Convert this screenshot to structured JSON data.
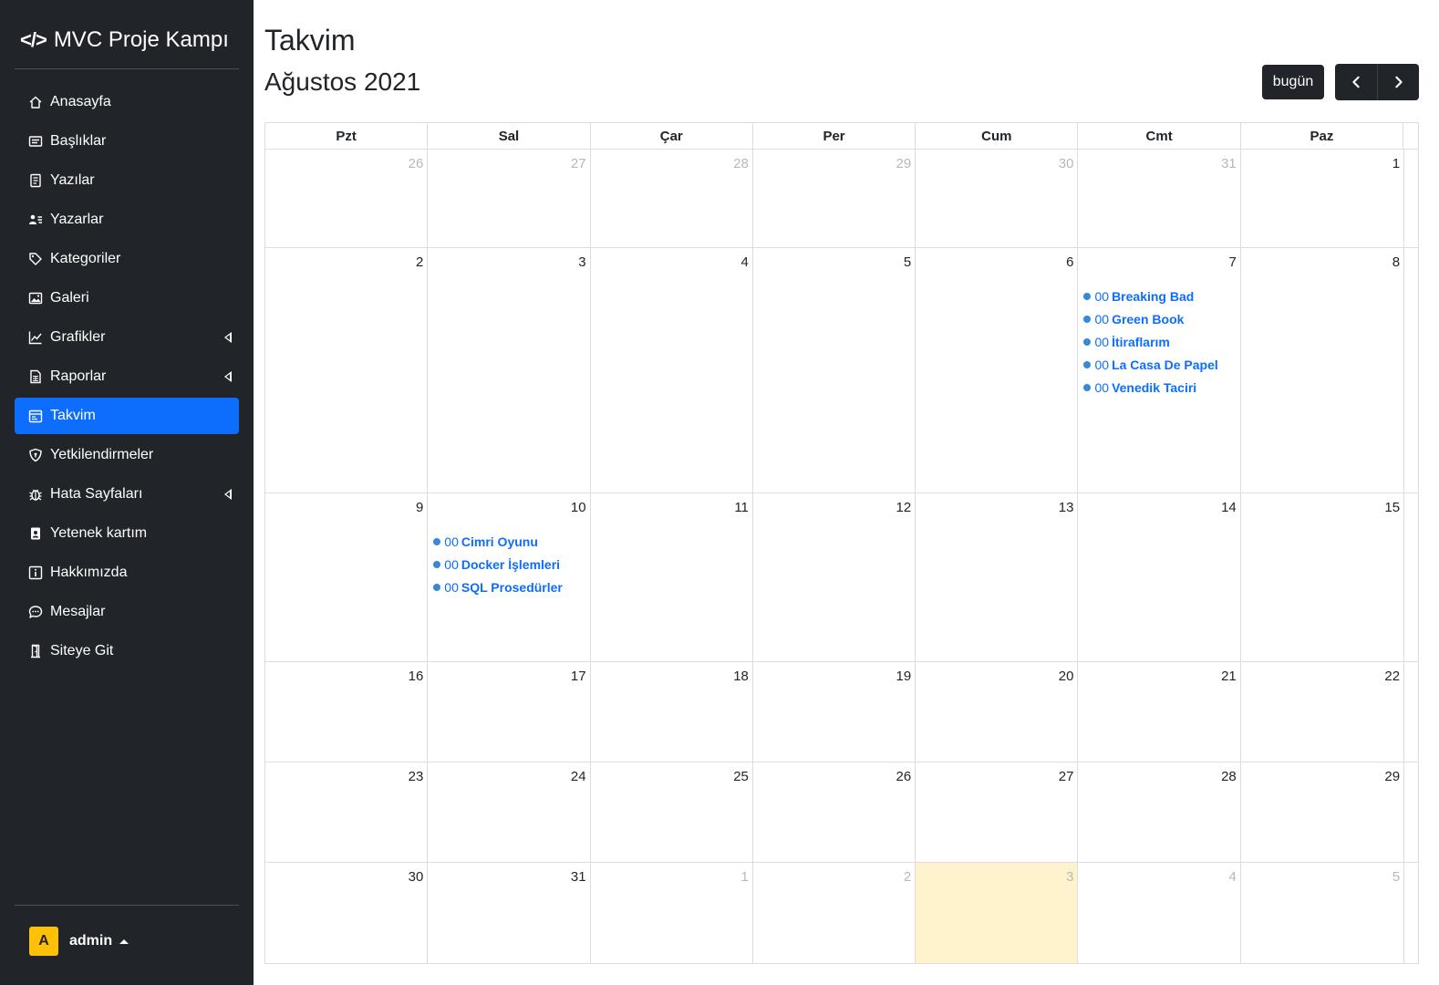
{
  "brand": {
    "name": "MVC Proje Kampı",
    "icon": "code-icon"
  },
  "nav": [
    {
      "label": "Anasayfa",
      "icon": "house-icon"
    },
    {
      "label": "Başlıklar",
      "icon": "card-heading-icon"
    },
    {
      "label": "Yazılar",
      "icon": "journal-text-icon"
    },
    {
      "label": "Yazarlar",
      "icon": "person-lines-icon"
    },
    {
      "label": "Kategoriler",
      "icon": "tags-icon"
    },
    {
      "label": "Galeri",
      "icon": "images-icon"
    },
    {
      "label": "Grafikler",
      "icon": "graph-up-icon",
      "expandable": true
    },
    {
      "label": "Raporlar",
      "icon": "file-spreadsheet-icon",
      "expandable": true
    },
    {
      "label": "Takvim",
      "icon": "calendar-icon",
      "active": true
    },
    {
      "label": "Yetkilendirmeler",
      "icon": "shield-icon"
    },
    {
      "label": "Hata Sayfaları",
      "icon": "bug-icon",
      "expandable": true
    },
    {
      "label": "Yetenek kartım",
      "icon": "person-badge-icon"
    },
    {
      "label": "Hakkımızda",
      "icon": "info-square-icon"
    },
    {
      "label": "Mesajlar",
      "icon": "chat-dots-icon"
    },
    {
      "label": "Siteye Git",
      "icon": "door-open-icon"
    }
  ],
  "user": {
    "initial": "A",
    "name": "admin"
  },
  "page": {
    "title": "Takvim"
  },
  "calendar": {
    "month_label": "Ağustos 2021",
    "today_button": "bugün",
    "weekdays": [
      "Pzt",
      "Sal",
      "Çar",
      "Per",
      "Cum",
      "Cmt",
      "Paz"
    ],
    "weeks": [
      {
        "days": [
          {
            "num": "26",
            "other": true
          },
          {
            "num": "27",
            "other": true
          },
          {
            "num": "28",
            "other": true
          },
          {
            "num": "29",
            "other": true
          },
          {
            "num": "30",
            "other": true
          },
          {
            "num": "31",
            "other": true
          },
          {
            "num": "1"
          }
        ]
      },
      {
        "days": [
          {
            "num": "2"
          },
          {
            "num": "3"
          },
          {
            "num": "4"
          },
          {
            "num": "5"
          },
          {
            "num": "6"
          },
          {
            "num": "7",
            "events": [
              {
                "time": "00",
                "title": "Breaking Bad"
              },
              {
                "time": "00",
                "title": "Green Book"
              },
              {
                "time": "00",
                "title": "İtiraflarım"
              },
              {
                "time": "00",
                "title": "La Casa De Papel"
              },
              {
                "time": "00",
                "title": "Venedik Taciri"
              }
            ]
          },
          {
            "num": "8"
          }
        ]
      },
      {
        "days": [
          {
            "num": "9"
          },
          {
            "num": "10",
            "events": [
              {
                "time": "00",
                "title": "Cimri Oyunu"
              },
              {
                "time": "00",
                "title": "Docker İşlemleri"
              },
              {
                "time": "00",
                "title": "SQL Prosedürler"
              }
            ]
          },
          {
            "num": "11"
          },
          {
            "num": "12"
          },
          {
            "num": "13"
          },
          {
            "num": "14"
          },
          {
            "num": "15"
          }
        ]
      },
      {
        "days": [
          {
            "num": "16"
          },
          {
            "num": "17"
          },
          {
            "num": "18"
          },
          {
            "num": "19"
          },
          {
            "num": "20"
          },
          {
            "num": "21"
          },
          {
            "num": "22"
          }
        ]
      },
      {
        "days": [
          {
            "num": "23"
          },
          {
            "num": "24"
          },
          {
            "num": "25"
          },
          {
            "num": "26"
          },
          {
            "num": "27"
          },
          {
            "num": "28"
          },
          {
            "num": "29"
          }
        ]
      },
      {
        "days": [
          {
            "num": "30"
          },
          {
            "num": "31"
          },
          {
            "num": "1",
            "other": true
          },
          {
            "num": "2",
            "other": true
          },
          {
            "num": "3",
            "other": true,
            "today": true
          },
          {
            "num": "4",
            "other": true
          },
          {
            "num": "5",
            "other": true
          }
        ]
      }
    ]
  },
  "colors": {
    "sidebar": "#212529",
    "active": "#0d6efd",
    "event_dot": "#3788d8",
    "today_bg": "#fff3cd",
    "avatar": "#ffc107"
  }
}
